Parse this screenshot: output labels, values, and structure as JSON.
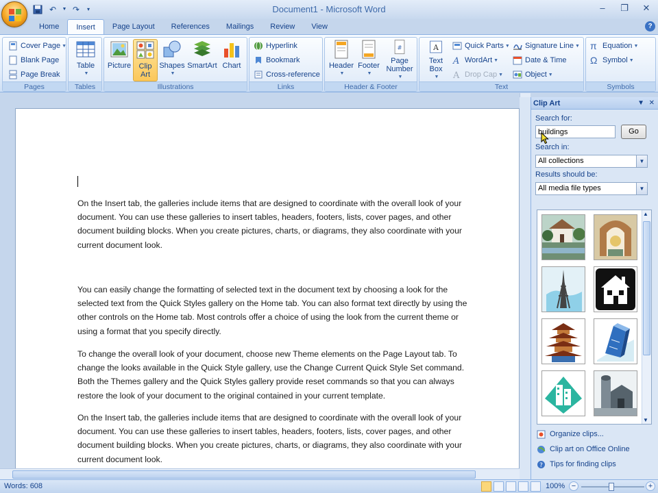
{
  "window": {
    "title": "Document1 - Microsoft Word"
  },
  "tabs": [
    "Home",
    "Insert",
    "Page Layout",
    "References",
    "Mailings",
    "Review",
    "View"
  ],
  "active_tab": "Insert",
  "ribbon": {
    "pages": {
      "label": "Pages",
      "cover_page": "Cover Page",
      "blank_page": "Blank Page",
      "page_break": "Page Break"
    },
    "tables": {
      "label": "Tables",
      "table": "Table"
    },
    "illustrations": {
      "label": "Illustrations",
      "picture": "Picture",
      "clip_art": "Clip Art",
      "shapes": "Shapes",
      "smartart": "SmartArt",
      "chart": "Chart"
    },
    "links": {
      "label": "Links",
      "hyperlink": "Hyperlink",
      "bookmark": "Bookmark",
      "cross_reference": "Cross-reference"
    },
    "header_footer": {
      "label": "Header & Footer",
      "header": "Header",
      "footer": "Footer",
      "page_number": "Page Number"
    },
    "text": {
      "label": "Text",
      "text_box": "Text Box",
      "quick_parts": "Quick Parts",
      "wordart": "WordArt",
      "drop_cap": "Drop Cap",
      "signature_line": "Signature Line",
      "date_time": "Date & Time",
      "object": "Object"
    },
    "symbols": {
      "label": "Symbols",
      "equation": "Equation",
      "symbol": "Symbol"
    }
  },
  "document": {
    "paragraphs": [
      "On the Insert tab, the galleries include items that are designed to coordinate with the overall look of your document. You can use these galleries to insert tables, headers, footers, lists, cover pages, and other document building blocks. When you create pictures, charts, or diagrams, they also coordinate with your current document look.",
      "You can easily change the formatting of selected text in the document text by choosing a look for the selected text from the Quick Styles gallery on the Home tab. You can also format text directly by using the other controls on the Home tab. Most controls offer a choice of using the look from the current theme or using a format that you specify directly.",
      "To change the overall look of your document, choose new Theme elements on the Page Layout tab. To change the looks available in the Quick Style gallery, use the Change Current Quick Style Set command. Both the Themes gallery and the Quick Styles gallery provide reset commands so that you can always restore the look of your document to the original contained in your current template.",
      "On the Insert tab, the galleries include items that are designed to coordinate with the overall look of your document. You can use these galleries to insert tables, headers, footers, lists, cover pages, and other document building blocks. When you create pictures, charts, or diagrams, they also coordinate with your current document look."
    ]
  },
  "clip_art_pane": {
    "title": "Clip Art",
    "search_label": "Search for:",
    "search_value": "buildings",
    "go_label": "Go",
    "search_in_label": "Search in:",
    "search_in_value": "All collections",
    "results_label": "Results should be:",
    "results_value": "All media file types",
    "links": {
      "organize": "Organize clips...",
      "online": "Clip art on Office Online",
      "tips": "Tips for finding clips"
    }
  },
  "status": {
    "words": "Words: 608",
    "zoom": "100%"
  }
}
